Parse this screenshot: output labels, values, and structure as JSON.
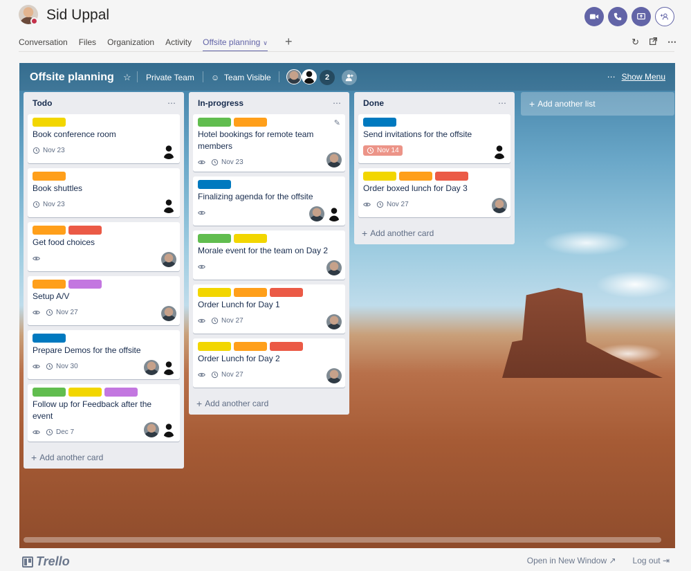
{
  "header": {
    "user_name": "Sid Uppal",
    "tabs": [
      {
        "label": "Conversation"
      },
      {
        "label": "Files"
      },
      {
        "label": "Organization"
      },
      {
        "label": "Activity"
      },
      {
        "label": "Offsite planning",
        "active": true
      }
    ],
    "call_icons": [
      "video-call-icon",
      "audio-call-icon",
      "screen-share-icon",
      "add-people-icon"
    ],
    "tool_icons": [
      "refresh-icon",
      "pop-out-icon",
      "more-icon"
    ],
    "accent_color": "#6264a7",
    "presence_color": "#c4314b"
  },
  "board": {
    "title": "Offsite planning",
    "private_label": "Private Team",
    "visible_label": "Team Visible",
    "member_count": "2",
    "show_menu": "Show Menu",
    "add_list_label": "Add another list"
  },
  "lists": [
    {
      "title": "Todo",
      "add_card_label": "Add another card",
      "cards": [
        {
          "labels": [
            "#f2d600"
          ],
          "title": "Book conference room",
          "due": "Nov 23",
          "members": [
            "person"
          ]
        },
        {
          "labels": [
            "#ff9f1a"
          ],
          "title": "Book shuttles",
          "due": "Nov 23",
          "members": [
            "person"
          ]
        },
        {
          "labels": [
            "#ff9f1a",
            "#eb5a46"
          ],
          "title": "Get food choices",
          "watch": true,
          "members": [
            "photo"
          ]
        },
        {
          "labels": [
            "#ff9f1a",
            "#c377e0"
          ],
          "title": "Setup A/V",
          "watch": true,
          "due": "Nov 27",
          "members": [
            "photo"
          ]
        },
        {
          "labels": [
            "#0079bf"
          ],
          "title": "Prepare Demos for the offsite",
          "watch": true,
          "due": "Nov 30",
          "members": [
            "photo",
            "person"
          ]
        },
        {
          "labels": [
            "#61bd4f",
            "#f2d600",
            "#c377e0"
          ],
          "title": "Follow up for Feedback after the event",
          "watch": true,
          "due": "Dec 7",
          "members": [
            "photo",
            "person"
          ]
        }
      ]
    },
    {
      "title": "In-progress",
      "add_card_label": "Add another card",
      "cards": [
        {
          "labels": [
            "#61bd4f",
            "#ff9f1a"
          ],
          "title": "Hotel bookings for remote team members",
          "watch": true,
          "due": "Nov 23",
          "members": [
            "photo"
          ],
          "editing": true
        },
        {
          "labels": [
            "#0079bf"
          ],
          "title": "Finalizing agenda for the offsite",
          "watch": true,
          "members": [
            "photo",
            "person"
          ]
        },
        {
          "labels": [
            "#61bd4f",
            "#f2d600"
          ],
          "title": "Morale event for the team on Day 2",
          "watch": true,
          "members": [
            "photo"
          ]
        },
        {
          "labels": [
            "#f2d600",
            "#ff9f1a",
            "#eb5a46"
          ],
          "title": "Order Lunch for Day 1",
          "watch": true,
          "due": "Nov 27",
          "members": [
            "photo"
          ]
        },
        {
          "labels": [
            "#f2d600",
            "#ff9f1a",
            "#eb5a46"
          ],
          "title": "Order Lunch for Day 2",
          "watch": true,
          "due": "Nov 27",
          "members": [
            "photo"
          ]
        }
      ]
    },
    {
      "title": "Done",
      "add_card_label": "Add another card",
      "cards": [
        {
          "labels": [
            "#0079bf"
          ],
          "title": "Send invitations for the offsite",
          "due": "Nov 14",
          "overdue": true,
          "members": [
            "person"
          ]
        },
        {
          "labels": [
            "#f2d600",
            "#ff9f1a",
            "#eb5a46"
          ],
          "title": "Order boxed lunch for Day 3",
          "watch": true,
          "due": "Nov 27",
          "members": [
            "photo"
          ]
        }
      ]
    }
  ],
  "footer": {
    "logo_text": "Trello",
    "open_new_window": "Open in New Window",
    "log_out": "Log out"
  }
}
